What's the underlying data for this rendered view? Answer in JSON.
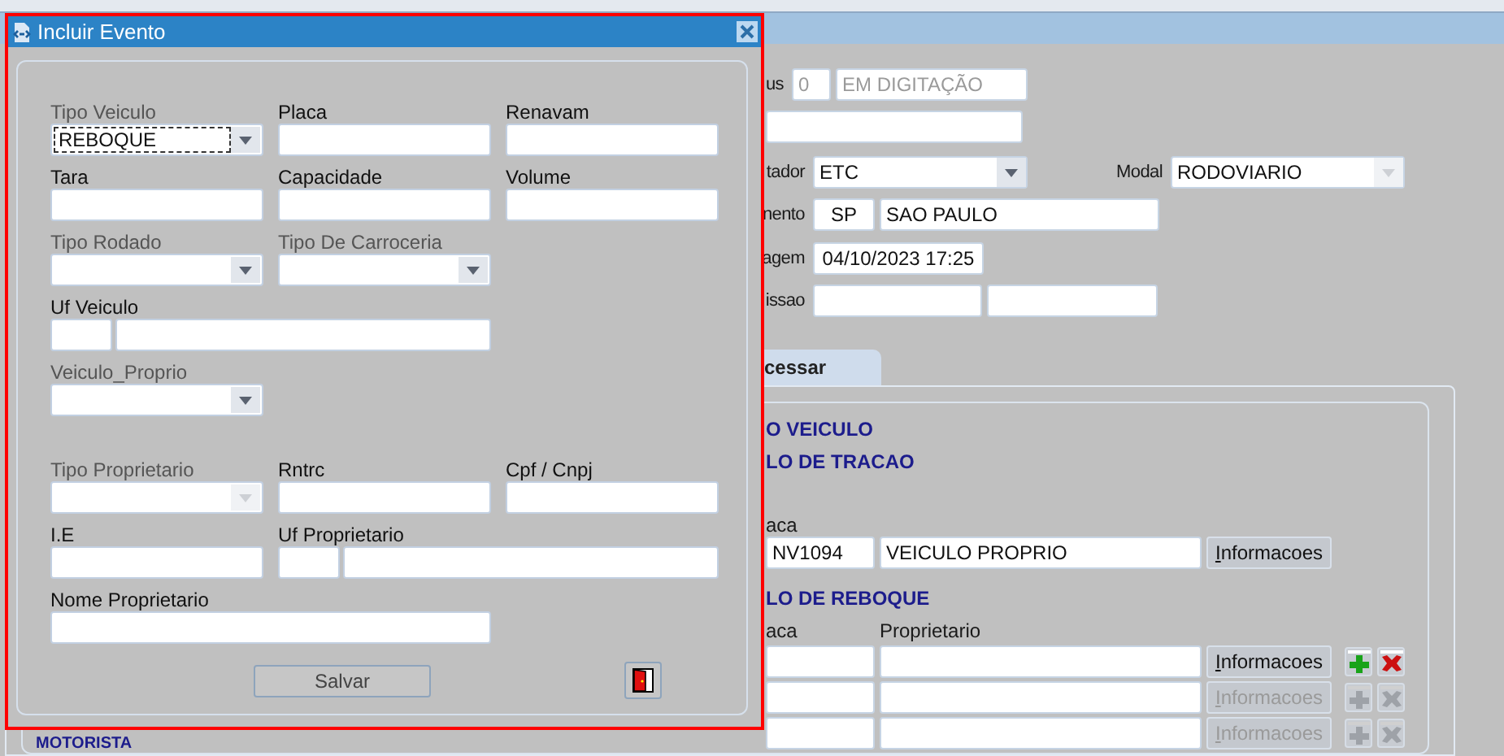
{
  "background": {
    "header_rows": [
      {
        "items": [
          {
            "kind": "label",
            "text": "us"
          },
          {
            "kind": "text",
            "value": "0",
            "disabled": true
          },
          {
            "kind": "text",
            "value": "EM DIGITAÇÃO",
            "disabled": true
          }
        ]
      },
      {
        "items": [
          {
            "kind": "text"
          }
        ]
      },
      {
        "items": [
          {
            "kind": "label",
            "text": "tador"
          },
          {
            "kind": "select",
            "value": "ETC",
            "disabled": false
          },
          {
            "kind": "label",
            "text": "Modal"
          },
          {
            "kind": "select",
            "value": "RODOVIARIO",
            "disabled": true
          }
        ]
      },
      {
        "items": [
          {
            "kind": "label",
            "text": "nento"
          },
          {
            "kind": "text",
            "value": "SP"
          },
          {
            "kind": "text",
            "value": "SAO PAULO"
          }
        ]
      },
      {
        "items": [
          {
            "kind": "label",
            "text": "agem"
          },
          {
            "kind": "text",
            "value": "04/10/2023 17:25"
          }
        ]
      },
      {
        "items": [
          {
            "kind": "label",
            "text": "issao"
          },
          {
            "kind": "text"
          },
          {
            "kind": "text"
          }
        ]
      }
    ],
    "tab": {
      "label": "cessar",
      "selected": true
    },
    "panel": {
      "headings": [
        "O VEICULO",
        "LO DE TRACAO"
      ],
      "traction": {
        "column_label": "aca",
        "plate": "NV1094",
        "owner": "VEICULO PROPRIO",
        "button": "Informacoes"
      },
      "trailer_heading": "LO DE REBOQUE",
      "trailer_columns": [
        "aca",
        "Proprietario"
      ],
      "trailer_rows": [
        {
          "button": "Informacoes",
          "enabled": true
        },
        {
          "button": "Informacoes",
          "enabled": false
        },
        {
          "button": "Informacoes",
          "enabled": false
        }
      ],
      "footer_heading": "MOTORISTA"
    }
  },
  "dialog": {
    "title": "Incluir Evento",
    "groups": [
      [
        [
          {
            "kind": "select",
            "label": "Tipo Veiculo",
            "value": "REBOQUE",
            "focused": true,
            "disabled": false
          },
          {
            "kind": "text",
            "label": "Placa"
          },
          {
            "kind": "text",
            "label": "Renavam"
          }
        ],
        [
          {
            "kind": "text",
            "label": "Tara"
          },
          {
            "kind": "text",
            "label": "Capacidade"
          },
          {
            "kind": "text",
            "label": "Volume"
          }
        ],
        [
          {
            "kind": "select",
            "label": "Tipo Rodado",
            "focused": false,
            "disabled": false
          },
          {
            "kind": "select",
            "label": "Tipo De Carroceria",
            "focused": false,
            "disabled": false
          }
        ],
        [
          {
            "kind": "split",
            "label": "Uf Veiculo"
          }
        ],
        [
          {
            "kind": "select",
            "label": "Veiculo_Proprio",
            "focused": false,
            "disabled": false
          }
        ]
      ],
      [
        [
          {
            "kind": "select",
            "label": "Tipo Proprietario",
            "focused": false,
            "disabled": true
          },
          {
            "kind": "text",
            "label": "Rntrc"
          },
          {
            "kind": "text",
            "label": "Cpf / Cnpj"
          }
        ],
        [
          {
            "kind": "text",
            "label": "I.E"
          },
          {
            "kind": "split",
            "label": "Uf Proprietario"
          }
        ],
        [
          {
            "kind": "wide",
            "label": "Nome Proprietario"
          }
        ]
      ]
    ],
    "save_button": "Salvar"
  }
}
